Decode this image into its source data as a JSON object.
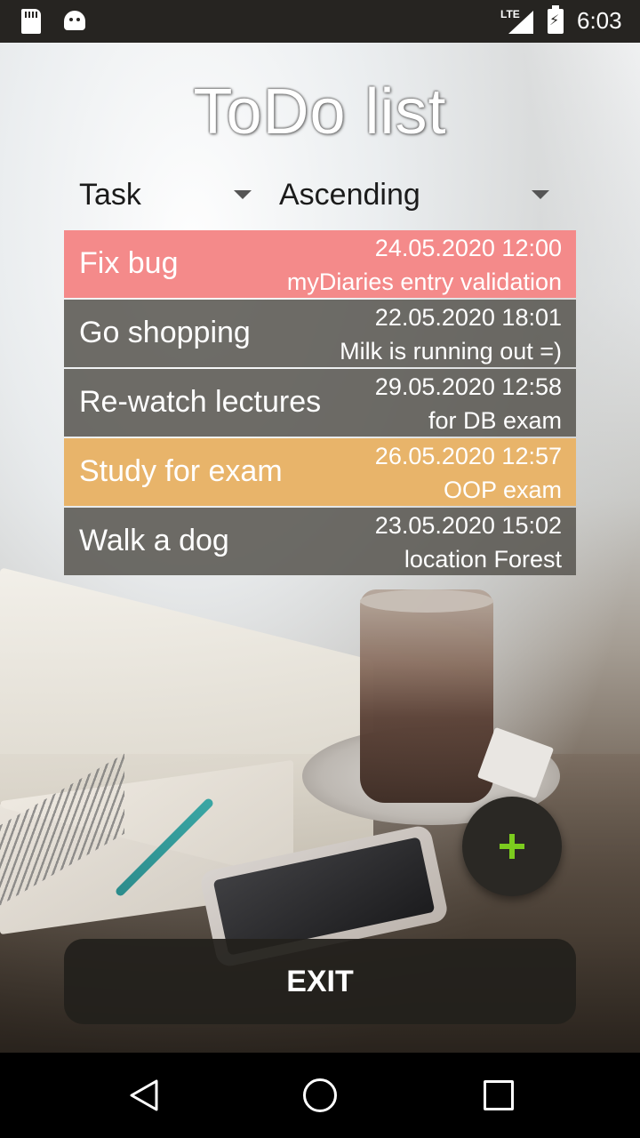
{
  "status_bar": {
    "time": "6:03",
    "network": "LTE",
    "icons": [
      "sd-card-icon",
      "android-debug-icon",
      "signal-icon",
      "battery-charging-icon"
    ]
  },
  "app": {
    "title": "ToDo list"
  },
  "sort": {
    "field": "Task",
    "order": "Ascending"
  },
  "tasks": [
    {
      "name": "Fix bug",
      "due": "24.05.2020 12:00",
      "note": "myDiaries entry validation",
      "color": "#f48a8a"
    },
    {
      "name": "Go shopping",
      "due": "22.05.2020 18:01",
      "note": "Milk is running out =)",
      "color": "#6b6a64"
    },
    {
      "name": "Re-watch lectures",
      "due": "29.05.2020 12:58",
      "note": "for DB exam",
      "color": "#6b6a64"
    },
    {
      "name": "Study for exam",
      "due": "26.05.2020 12:57",
      "note": "OOP exam",
      "color": "#e8b46a"
    },
    {
      "name": "Walk a dog",
      "due": "23.05.2020 15:02",
      "note": "location Forest",
      "color": "#6b6a64"
    }
  ],
  "fab": {
    "icon": "plus-icon",
    "icon_color": "#7ccc1e"
  },
  "exit_label": "EXIT",
  "nav_bar": {
    "icons": [
      "back-icon",
      "home-icon",
      "recents-icon"
    ]
  }
}
